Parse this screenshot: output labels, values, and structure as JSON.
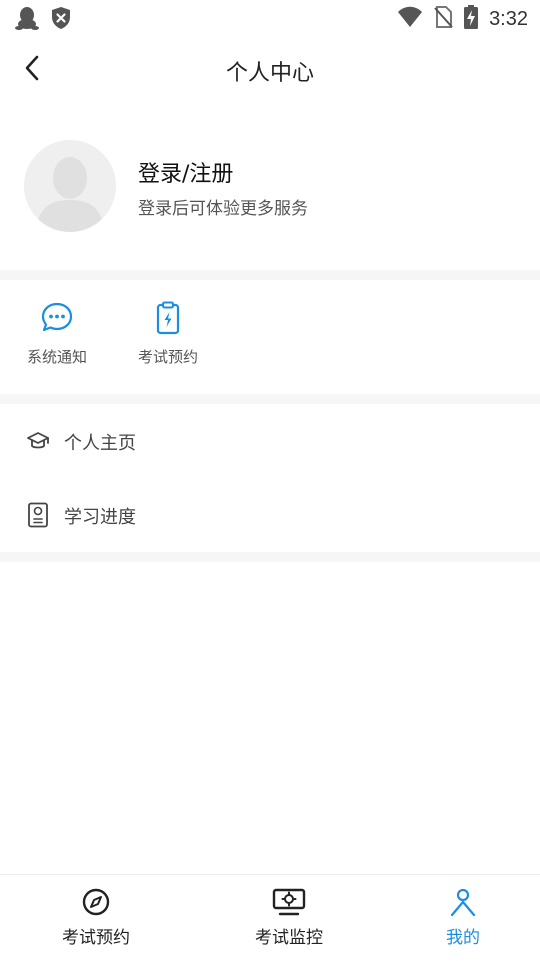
{
  "status_bar": {
    "time": "3:32",
    "icons": [
      "qq-icon",
      "shield-x-icon",
      "wifi-icon",
      "no-sim-icon",
      "battery-charging-icon"
    ]
  },
  "header": {
    "title": "个人中心",
    "back_icon": "chevron-left-icon"
  },
  "profile": {
    "login_label": "登录/注册",
    "subtitle": "登录后可体验更多服务",
    "avatar_icon": "default-avatar-icon"
  },
  "quick_actions": [
    {
      "label": "系统通知",
      "icon": "chat-bubble-icon"
    },
    {
      "label": "考试预约",
      "icon": "clipboard-bolt-icon"
    }
  ],
  "menu": [
    {
      "label": "个人主页",
      "icon": "graduation-cap-icon"
    },
    {
      "label": "学习进度",
      "icon": "certificate-icon"
    }
  ],
  "bottom_nav": {
    "items": [
      {
        "label": "考试预约",
        "icon": "compass-icon",
        "active": false
      },
      {
        "label": "考试监控",
        "icon": "monitor-gear-icon",
        "active": false
      },
      {
        "label": "我的",
        "icon": "person-icon",
        "active": true
      }
    ]
  },
  "colors": {
    "accent": "#1a8fe0",
    "divider": "#f6f6f6",
    "text_primary": "#222222",
    "text_secondary": "#555555"
  }
}
